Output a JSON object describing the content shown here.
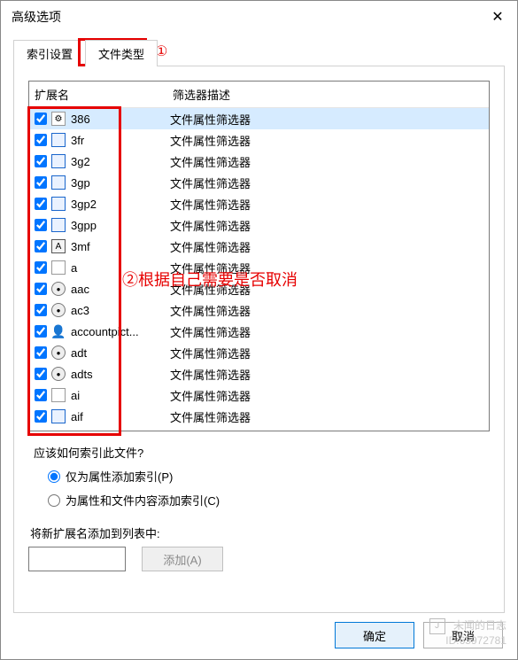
{
  "window": {
    "title": "高级选项",
    "close": "✕"
  },
  "tabs": {
    "index_settings": "索引设置",
    "file_types": "文件类型"
  },
  "annotations": {
    "ann1": "①",
    "ann2": "②根据自己需要是否取消"
  },
  "list": {
    "header_ext": "扩展名",
    "header_desc": "筛选器描述",
    "rows": [
      {
        "checked": true,
        "icon": "gear",
        "ext": "386",
        "desc": "文件属性筛选器",
        "selected": true
      },
      {
        "checked": true,
        "icon": "blue",
        "ext": "3fr",
        "desc": "文件属性筛选器"
      },
      {
        "checked": true,
        "icon": "blue",
        "ext": "3g2",
        "desc": "文件属性筛选器"
      },
      {
        "checked": true,
        "icon": "blue",
        "ext": "3gp",
        "desc": "文件属性筛选器"
      },
      {
        "checked": true,
        "icon": "blue",
        "ext": "3gp2",
        "desc": "文件属性筛选器"
      },
      {
        "checked": true,
        "icon": "blue",
        "ext": "3gpp",
        "desc": "文件属性筛选器"
      },
      {
        "checked": true,
        "icon": "dark",
        "ext": "3mf",
        "desc": "文件属性筛选器"
      },
      {
        "checked": true,
        "icon": "blank",
        "ext": "a",
        "desc": "文件属性筛选器"
      },
      {
        "checked": true,
        "icon": "circle",
        "ext": "aac",
        "desc": "文件属性筛选器"
      },
      {
        "checked": true,
        "icon": "circle",
        "ext": "ac3",
        "desc": "文件属性筛选器"
      },
      {
        "checked": true,
        "icon": "person",
        "ext": "accountpict...",
        "desc": "文件属性筛选器"
      },
      {
        "checked": true,
        "icon": "circle",
        "ext": "adt",
        "desc": "文件属性筛选器"
      },
      {
        "checked": true,
        "icon": "circle",
        "ext": "adts",
        "desc": "文件属性筛选器"
      },
      {
        "checked": true,
        "icon": "blank",
        "ext": "ai",
        "desc": "文件属性筛选器"
      },
      {
        "checked": true,
        "icon": "blue",
        "ext": "aif",
        "desc": "文件属性筛选器"
      }
    ]
  },
  "index_question": "应该如何索引此文件?",
  "radio": {
    "properties_only": "仅为属性添加索引(P)",
    "properties_and_content": "为属性和文件内容添加索引(C)"
  },
  "add": {
    "label": "将新扩展名添加到列表中:",
    "button": "添加(A)",
    "value": ""
  },
  "footer": {
    "ok": "确定",
    "cancel": "取消"
  },
  "watermark": {
    "line1": "未闻的日志",
    "line2": "ID:65972781"
  }
}
